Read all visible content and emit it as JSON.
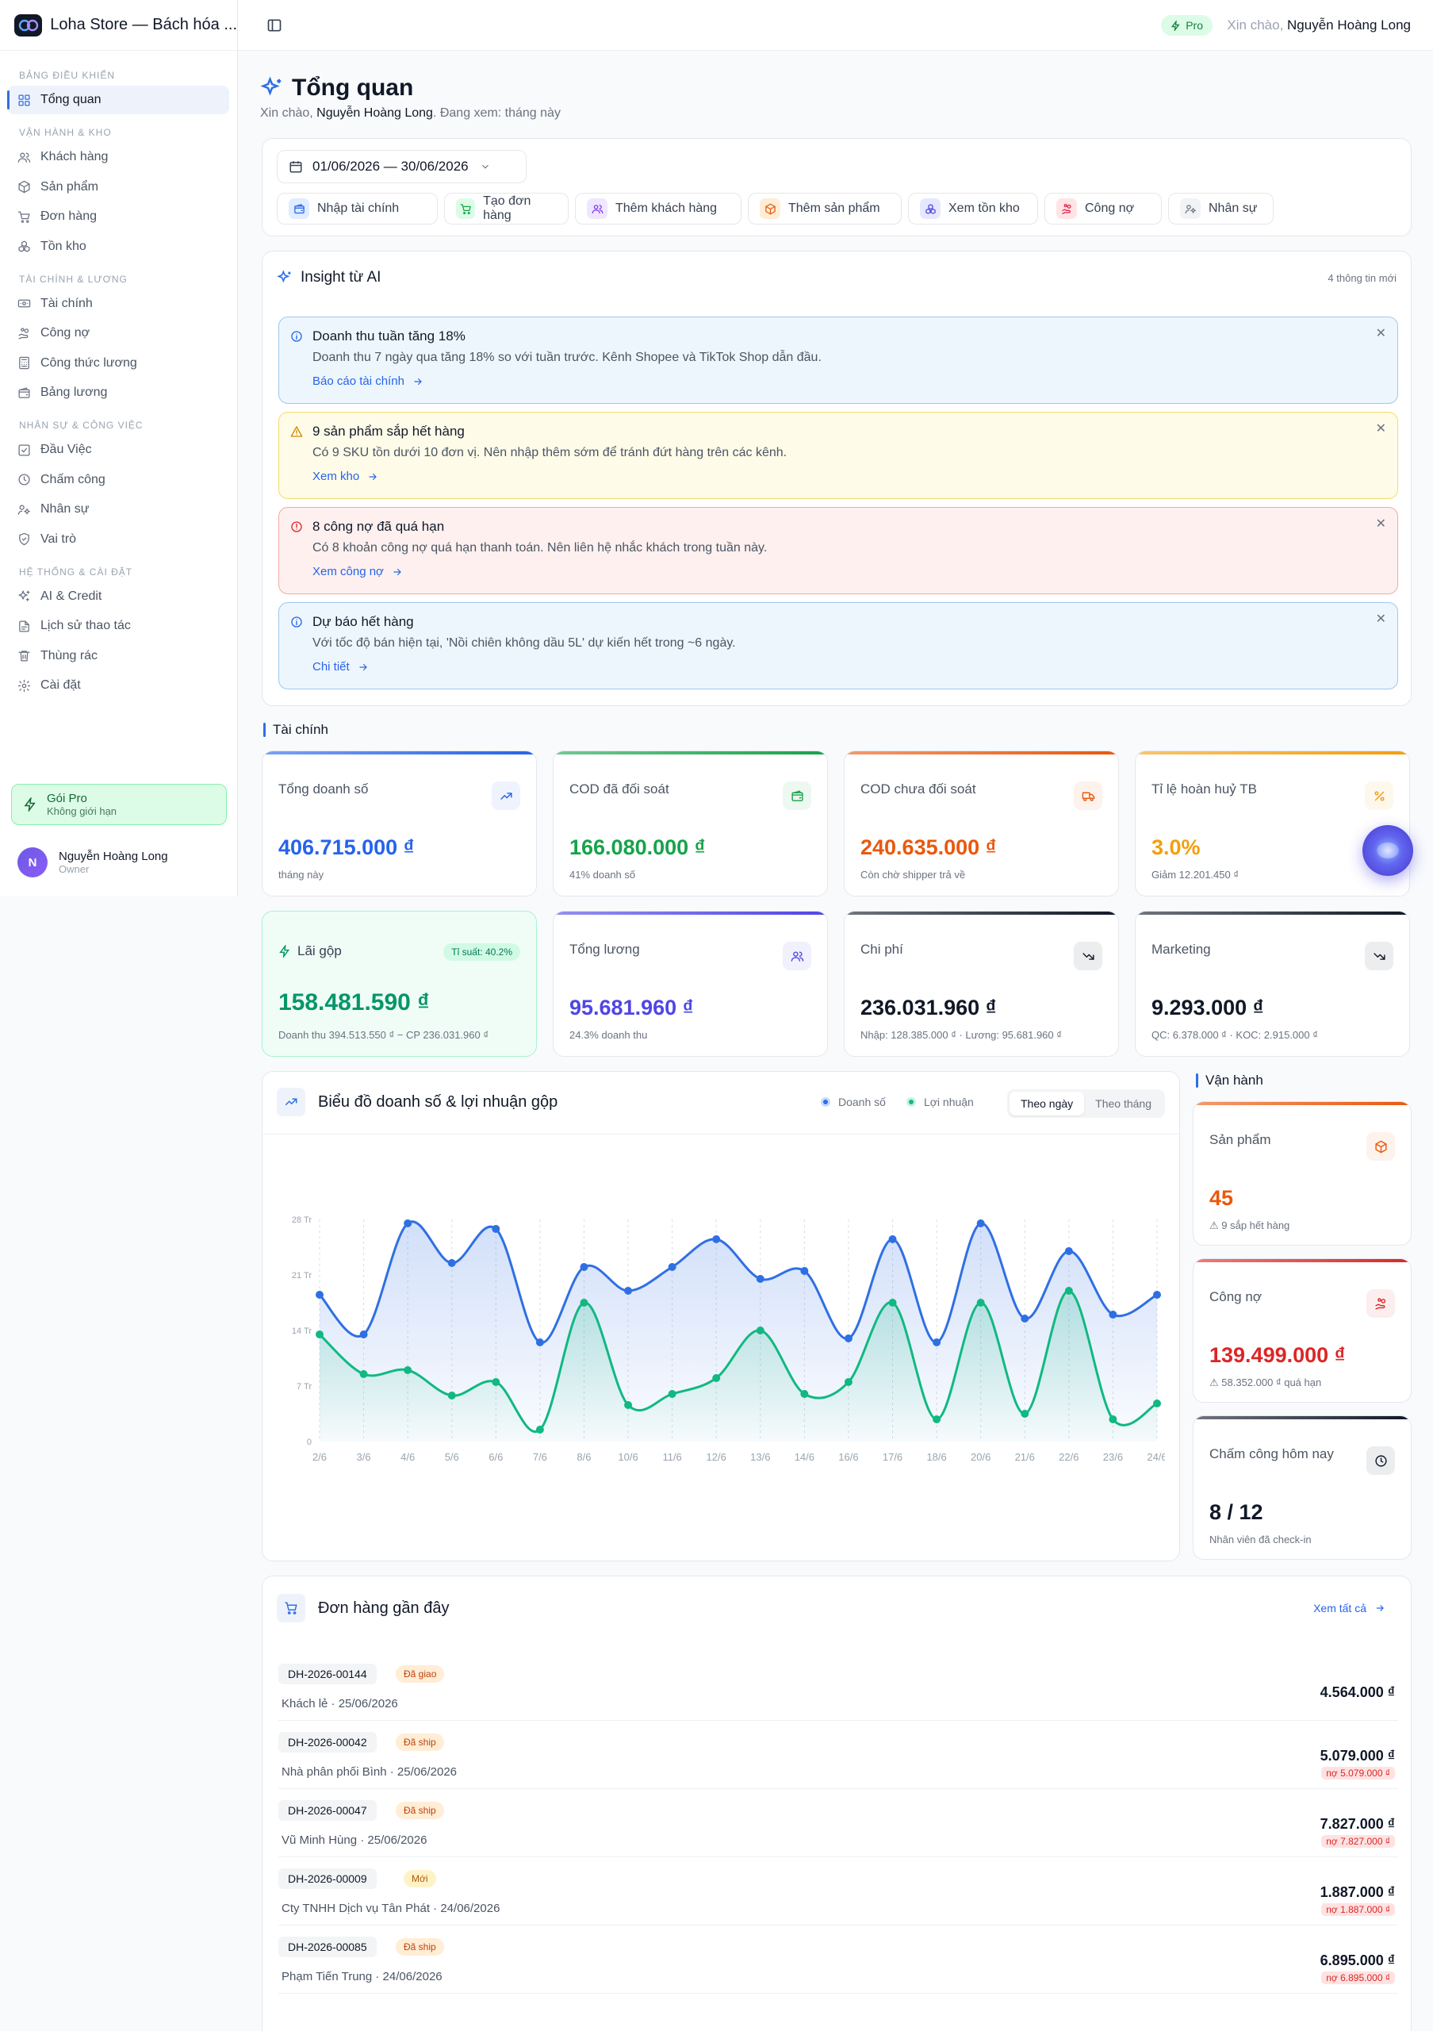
{
  "app": {
    "store_name": "Loha Store — Bách hóa ...",
    "plan_badge": "Pro",
    "greeting_prefix": "Xin chào,",
    "user_name": "Nguyễn Hoàng Long"
  },
  "sidebar": {
    "sections": [
      {
        "title": "Bảng điều khiển",
        "items": [
          {
            "label": "Tổng quan",
            "icon": "grid-icon",
            "active": true
          }
        ]
      },
      {
        "title": "Vận hành & Kho",
        "items": [
          {
            "label": "Khách hàng",
            "icon": "users-icon"
          },
          {
            "label": "Sản phẩm",
            "icon": "package-icon"
          },
          {
            "label": "Đơn hàng",
            "icon": "cart-icon"
          },
          {
            "label": "Tồn kho",
            "icon": "boxes-icon"
          }
        ]
      },
      {
        "title": "Tài chính & Lương",
        "items": [
          {
            "label": "Tài chính",
            "icon": "banknote-icon"
          },
          {
            "label": "Công nợ",
            "icon": "hand-coins-icon"
          },
          {
            "label": "Công thức lương",
            "icon": "calculator-icon"
          },
          {
            "label": "Bảng lương",
            "icon": "wallet-icon"
          }
        ]
      },
      {
        "title": "Nhân sự & Công việc",
        "items": [
          {
            "label": "Đầu Việc",
            "icon": "check-square-icon"
          },
          {
            "label": "Chấm công",
            "icon": "clock-icon"
          },
          {
            "label": "Nhân sự",
            "icon": "user-group-icon"
          },
          {
            "label": "Vai trò",
            "icon": "shield-icon"
          }
        ]
      },
      {
        "title": "Hệ thống & Cài đặt",
        "items": [
          {
            "label": "AI & Credit",
            "icon": "sparkles-icon"
          },
          {
            "label": "Lịch sử thao tác",
            "icon": "history-icon"
          },
          {
            "label": "Thùng rác",
            "icon": "trash-icon"
          },
          {
            "label": "Cài đặt",
            "icon": "gear-icon"
          }
        ]
      }
    ],
    "upgrade": {
      "title": "Gói Pro",
      "subtitle": "Không giới hạn"
    },
    "user": {
      "initial": "N",
      "name": "Nguyễn Hoàng Long",
      "role": "Owner"
    }
  },
  "page": {
    "title": "Tổng quan",
    "subtitle_prefix": "Xin chào,",
    "subtitle_name": "Nguyễn Hoàng Long",
    "subtitle_suffix": ". Đang xem: tháng này"
  },
  "toolbar": {
    "date_range": "01/06/2026 — 30/06/2026",
    "actions": [
      {
        "label": "Nhập tài chính",
        "icon": "wallet-icon",
        "color": "#2563eb",
        "bg": "#e0ecff"
      },
      {
        "label": "Tạo đơn hàng",
        "icon": "cart-icon",
        "color": "#16a34a",
        "bg": "#dcfce7"
      },
      {
        "label": "Thêm khách hàng",
        "icon": "users-icon",
        "color": "#7c3aed",
        "bg": "#efe7ff"
      },
      {
        "label": "Thêm sản phẩm",
        "icon": "package-icon",
        "color": "#ea580c",
        "bg": "#ffedd5"
      },
      {
        "label": "Xem tồn kho",
        "icon": "boxes-icon",
        "color": "#4f46e5",
        "bg": "#e6e8ff"
      },
      {
        "label": "Công nợ",
        "icon": "hand-coins-icon",
        "color": "#e11d48",
        "bg": "#ffe4e6"
      },
      {
        "label": "Nhân sự",
        "icon": "user-group-icon",
        "color": "#6b7280",
        "bg": "#f1f3f5"
      }
    ]
  },
  "insight": {
    "title": "Insight từ AI",
    "count": "4 thông tin mới",
    "alerts": [
      {
        "title": "Doanh thu tuần tăng 18%",
        "desc": "Doanh thu 7 ngày qua tăng 18% so với tuần trước. Kênh Shopee và TikTok Shop dẫn đầu.",
        "link": "Báo cáo tài chính",
        "type": "info"
      },
      {
        "title": "9 sản phẩm sắp hết hàng",
        "desc": "Có 9 SKU tồn dưới 10 đơn vị. Nên nhập thêm sớm để tránh đứt hàng trên các kênh.",
        "link": "Xem kho",
        "type": "warning"
      },
      {
        "title": "8 công nợ đã quá hạn",
        "desc": "Có 8 khoản công nợ quá hạn thanh toán. Nên liên hệ nhắc khách trong tuần này.",
        "link": "Xem công nợ",
        "type": "danger"
      },
      {
        "title": "Dự báo hết hàng",
        "desc": "Với tốc độ bán hiện tại, 'Nồi chiên không dầu 5L' dự kiến hết trong ~6 ngày.",
        "link": "Chi tiết",
        "type": "info"
      }
    ]
  },
  "finance": {
    "heading": "Tài chính",
    "cards": [
      {
        "label": "Tổng doanh số",
        "value": "406.715.000 ₫",
        "sub": "tháng này",
        "color": "#2563eb",
        "icon": "trending-up-icon"
      },
      {
        "label": "COD đã đối soát",
        "value": "166.080.000 ₫",
        "sub": "41% doanh số",
        "color": "#16a34a",
        "icon": "wallet-icon"
      },
      {
        "label": "COD chưa đối soát",
        "value": "240.635.000 ₫",
        "sub": "Còn chờ shipper trả về",
        "color": "#ea580c",
        "icon": "truck-icon"
      },
      {
        "label": "Tỉ lệ hoàn huỷ TB",
        "value": "3.0%",
        "sub": "Giảm 12.201.450 ₫",
        "color": "#f59e0b",
        "icon": "percent-icon"
      }
    ],
    "profit": {
      "label": "Lãi gộp",
      "badge": "Tỉ suất: 40.2%",
      "value": "158.481.590 ₫",
      "sub": "Doanh thu 394.513.550 ₫ − CP 236.031.960 ₫"
    },
    "cards2": [
      {
        "label": "Tổng lương",
        "value": "95.681.960 ₫",
        "sub": "24.3% doanh thu",
        "color": "#4f46e5",
        "icon": "users-icon"
      },
      {
        "label": "Chi phí",
        "value": "236.031.960 ₫",
        "sub": "Nhập: 128.385.000 ₫ · Lương: 95.681.960 ₫",
        "color": "#111827",
        "icon": "trending-down-icon"
      },
      {
        "label": "Marketing",
        "value": "9.293.000 ₫",
        "sub": "QC: 6.378.000 ₫ · KOC: 2.915.000 ₫",
        "color": "#111827",
        "icon": "trending-down-icon"
      }
    ]
  },
  "chart_section": {
    "title": "Biểu đồ doanh số & lợi nhuận gộp",
    "legend": [
      "Doanh số",
      "Lợi nhuận"
    ],
    "tabs": [
      "Theo ngày",
      "Theo tháng"
    ],
    "active_tab": "Theo ngày"
  },
  "chart_data": {
    "type": "line",
    "x": [
      "2/6",
      "3/6",
      "4/6",
      "5/6",
      "6/6",
      "7/6",
      "8/6",
      "10/6",
      "11/6",
      "12/6",
      "13/6",
      "14/6",
      "16/6",
      "17/6",
      "18/6",
      "20/6",
      "21/6",
      "22/6",
      "23/6",
      "24/6"
    ],
    "yticks": [
      "0",
      "7 Tr",
      "14 Tr",
      "21 Tr",
      "28 Tr"
    ],
    "ylim": [
      0,
      28
    ],
    "series": [
      {
        "name": "Doanh số",
        "color": "#2f6fe4",
        "values": [
          18.5,
          13.5,
          27.5,
          22.5,
          26.8,
          12.5,
          22,
          19,
          22,
          25.5,
          20.5,
          21.5,
          13,
          25.5,
          12.5,
          27.5,
          15.5,
          24,
          16,
          18.5
        ]
      },
      {
        "name": "Lợi nhuận",
        "color": "#10b981",
        "values": [
          13.5,
          8.5,
          9,
          5.8,
          7.5,
          1.5,
          17.5,
          4.6,
          6,
          8,
          14,
          6,
          7.5,
          17.5,
          2.8,
          17.5,
          3.5,
          19,
          2.8,
          4.8
        ]
      }
    ]
  },
  "ops": {
    "heading": "Vận hành",
    "cards": [
      {
        "label": "Sản phẩm",
        "value": "45",
        "sub": "⚠ 9 sắp hết hàng",
        "color": "#ea580c",
        "icon": "package-icon"
      },
      {
        "label": "Công nợ",
        "value": "139.499.000 ₫",
        "sub": "⚠ 58.352.000 ₫ quá hạn",
        "color": "#dc2626",
        "icon": "hand-coins-icon"
      },
      {
        "label": "Chấm công hôm nay",
        "value": "8 / 12",
        "sub": "Nhân viên đã check-in",
        "color": "#111827",
        "icon": "clock-icon"
      }
    ]
  },
  "orders": {
    "title": "Đơn hàng gần đây",
    "view_all": "Xem tất cả",
    "rows": [
      {
        "code": "DH-2026-00144",
        "status": "Đã giao",
        "customer": "Khách lẻ · 25/06/2026",
        "amount": "4.564.000 ₫",
        "due": ""
      },
      {
        "code": "DH-2026-00042",
        "status": "Đã ship",
        "customer": "Nhà phân phối Bình · 25/06/2026",
        "amount": "5.079.000 ₫",
        "due": "nợ 5.079.000 ₫"
      },
      {
        "code": "DH-2026-00047",
        "status": "Đã ship",
        "customer": "Vũ Minh Hùng · 25/06/2026",
        "amount": "7.827.000 ₫",
        "due": "nợ 7.827.000 ₫"
      },
      {
        "code": "DH-2026-00009",
        "status": "Mới",
        "customer": "Cty TNHH Dịch vụ Tân Phát · 24/06/2026",
        "amount": "1.887.000 ₫",
        "due": "nợ 1.887.000 ₫"
      },
      {
        "code": "DH-2026-00085",
        "status": "Đã ship",
        "customer": "Phạm Tiến Trung · 24/06/2026",
        "amount": "6.895.000 ₫",
        "due": "nợ 6.895.000 ₫"
      }
    ]
  }
}
